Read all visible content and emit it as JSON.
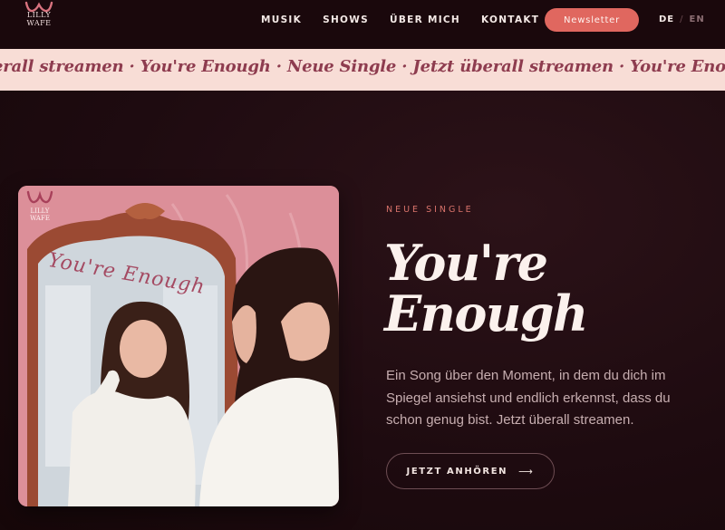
{
  "brand": {
    "logo_line1": "LILLY",
    "logo_line2": "WAFE"
  },
  "nav": {
    "items": [
      {
        "label": "MUSIK"
      },
      {
        "label": "SHOWS"
      },
      {
        "label": "ÜBER MICH"
      },
      {
        "label": "KONTAKT"
      }
    ],
    "newsletter_label": "Newsletter",
    "lang_active": "DE",
    "lang_separator": "/",
    "lang_inactive": "EN"
  },
  "marquee": {
    "text": "erall streamen · You're Enough · Neue Single · Jetzt überall streamen · You're Enough"
  },
  "cover": {
    "script_text": "You're Enough",
    "logo_line1": "LILLY",
    "logo_line2": "WAFE"
  },
  "hero": {
    "eyebrow": "NEUE SINGLE",
    "title_line1": "You're",
    "title_line2": "Enough",
    "description": "Ein Song über den Moment, in dem du dich im Spiegel ansiehst und endlich erkennst, dass du schon genug bist. Jetzt überall streamen.",
    "cta_label": "JETZT ANHÖREN",
    "cta_icon": "arrow-right-icon"
  },
  "colors": {
    "accent": "#e0675f",
    "background": "#1e0b10",
    "marquee_bg": "#f8ddd6",
    "marquee_text": "#8e3c4f"
  }
}
